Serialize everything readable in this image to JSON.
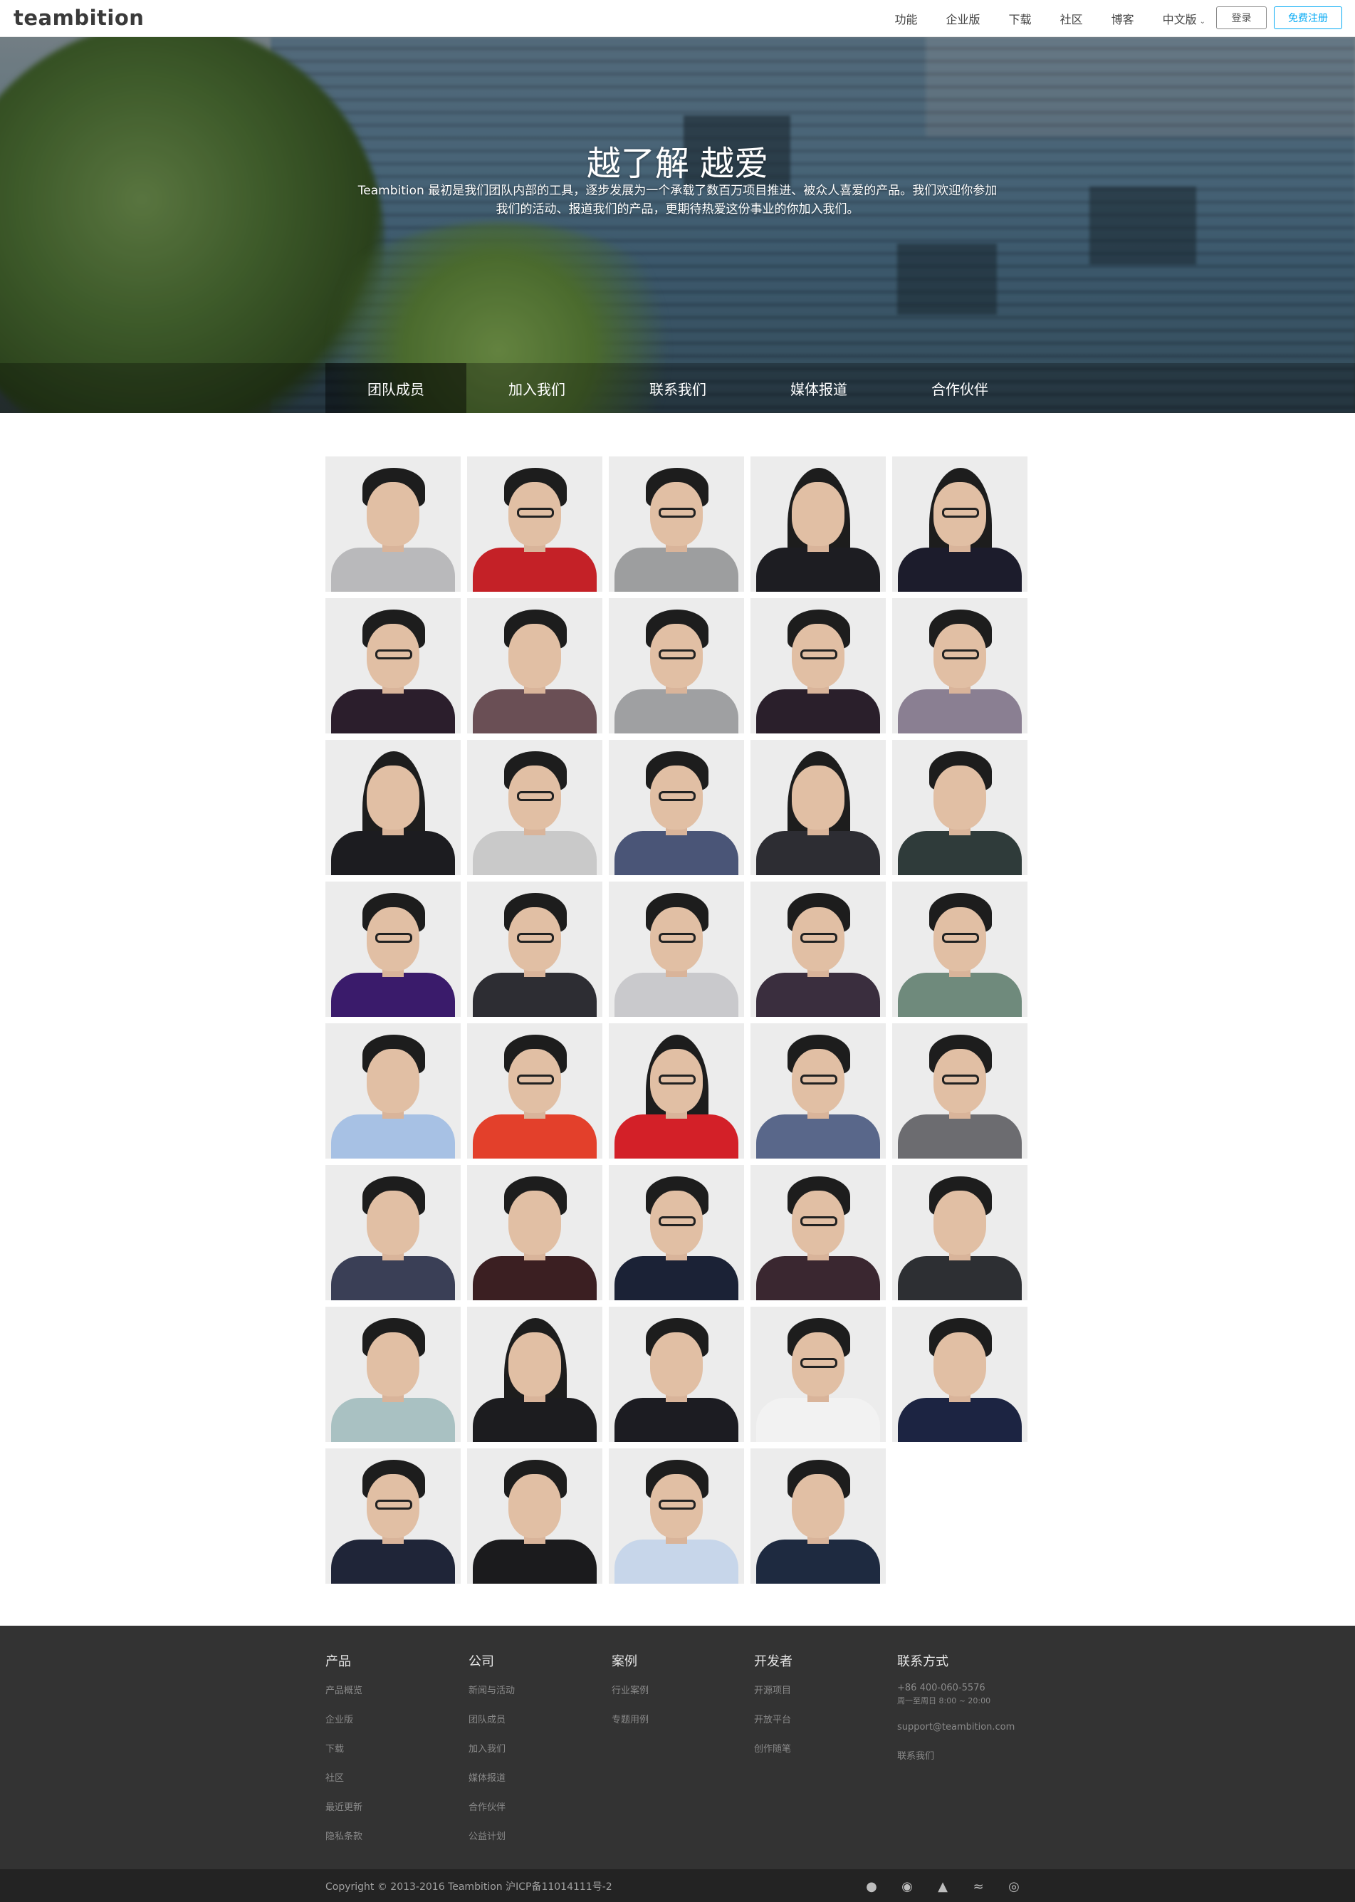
{
  "header": {
    "logo": "teambition",
    "nav": [
      {
        "label": "功能"
      },
      {
        "label": "企业版"
      },
      {
        "label": "下载"
      },
      {
        "label": "社区"
      },
      {
        "label": "博客"
      },
      {
        "label": "中文版"
      }
    ],
    "login_label": "登录",
    "signup_label": "免费注册"
  },
  "hero": {
    "title": "越了解 越爱",
    "description": "Teambition 最初是我们团队内部的工具，逐步发展为一个承载了数百万项目推进、被众人喜爱的产品。我们欢迎你参加我们的活动、报道我们的产品，更期待热爱这份事业的你加入我们。"
  },
  "tabs": [
    {
      "label": "团队成员",
      "active": true
    },
    {
      "label": "加入我们",
      "active": false
    },
    {
      "label": "联系我们",
      "active": false
    },
    {
      "label": "媒体报道",
      "active": false
    },
    {
      "label": "合作伙伴",
      "active": false
    }
  ],
  "team": {
    "count": 39,
    "shirt_colors": [
      "#b9b9bb",
      "#c42127",
      "#9d9e9f",
      "#1d1d22",
      "#1c1c2c",
      "#2b1e2c",
      "#6a4f55",
      "#9fa0a2",
      "#2a1f2b",
      "#8a7f92",
      "#1c1c20",
      "#c9c9c9",
      "#4a5577",
      "#2d2d33",
      "#2f3b3a",
      "#3a1b6b",
      "#2d2d33",
      "#c9c9cc",
      "#3a2e3e",
      "#6f8a7c",
      "#a7c1e4",
      "#e3402b",
      "#d32028",
      "#59678a",
      "#6c6c70",
      "#3a3f56",
      "#3b1f22",
      "#1b2236",
      "#3a2730",
      "#2d2f33",
      "#a9c1c2",
      "#1c1c1f",
      "#1c1c22",
      "#f2f2f2",
      "#1c2442",
      "#1f2538",
      "#1b1b1d",
      "#c7d6ea",
      "#1e2a40"
    ],
    "long_hair": [
      3,
      4,
      10,
      13,
      22,
      31
    ],
    "glasses": [
      1,
      2,
      4,
      5,
      7,
      8,
      9,
      11,
      12,
      15,
      16,
      17,
      18,
      19,
      21,
      22,
      23,
      24,
      27,
      28,
      33,
      35,
      37
    ]
  },
  "footer": {
    "columns": [
      {
        "title": "产品",
        "links": [
          "产品概览",
          "企业版",
          "下载",
          "社区",
          "最近更新",
          "隐私条款"
        ]
      },
      {
        "title": "公司",
        "links": [
          "新闻与活动",
          "团队成员",
          "加入我们",
          "媒体报道",
          "合作伙伴",
          "公益计划"
        ]
      },
      {
        "title": "案例",
        "links": [
          "行业案例",
          "专题用例"
        ]
      },
      {
        "title": "开发者",
        "links": [
          "开源项目",
          "开放平台",
          "创作随笔"
        ]
      }
    ],
    "contact": {
      "title": "联系方式",
      "phone": "+86 400-060-5576",
      "hours": "周一至周日 8:00 ~ 20:00",
      "email": "support@teambition.com",
      "contact_link": "联系我们"
    },
    "copyright": "Copyright © 2013-2016 Teambition  沪ICP备11014111号-2",
    "social_icons": [
      "wechat-icon",
      "weibo-icon",
      "qq-icon",
      "rss-icon",
      "dribbble-icon"
    ]
  }
}
